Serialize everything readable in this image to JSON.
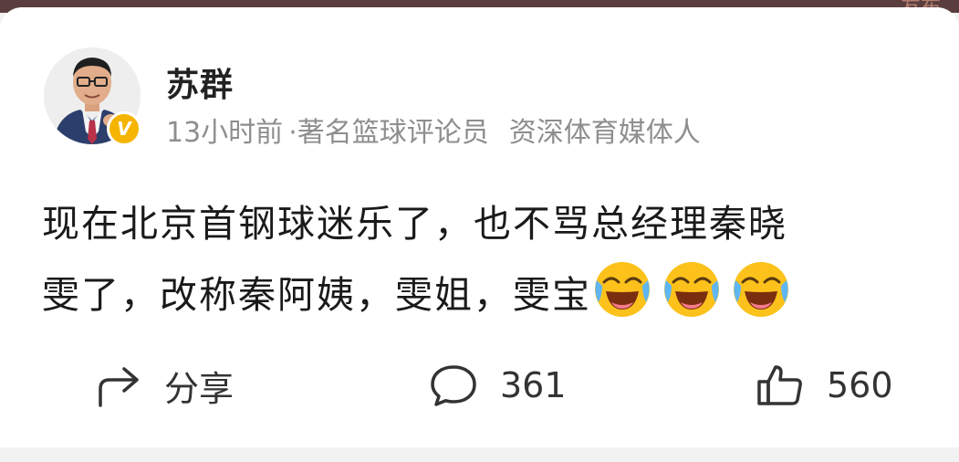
{
  "header_strip": {
    "text": "友布"
  },
  "post": {
    "author": {
      "name": "苏群",
      "verified_icon": "verified-v-badge-icon",
      "verified_label": "V"
    },
    "time": "13小时前",
    "meta_separator": "·",
    "titles": [
      "著名篮球评论员",
      "资深体育媒体人"
    ],
    "content": {
      "line1": "现在北京首钢球迷乐了，也不骂总经理秦晓",
      "line2": "雯了，改称秦阿姨，雯姐，雯宝",
      "emojis": [
        "laughing-crying-emoji",
        "laughing-crying-emoji",
        "laughing-crying-emoji"
      ]
    }
  },
  "actions": {
    "share": {
      "icon": "share-arrow-icon",
      "label": "分享"
    },
    "comment": {
      "icon": "comment-bubble-icon",
      "count": "361"
    },
    "like": {
      "icon": "thumbs-up-icon",
      "count": "560"
    }
  },
  "colors": {
    "badge": "#f5b400",
    "meta_text": "#8e8e8e",
    "body_text": "#1a1a1a",
    "top_strip": "#5a3e3e"
  }
}
